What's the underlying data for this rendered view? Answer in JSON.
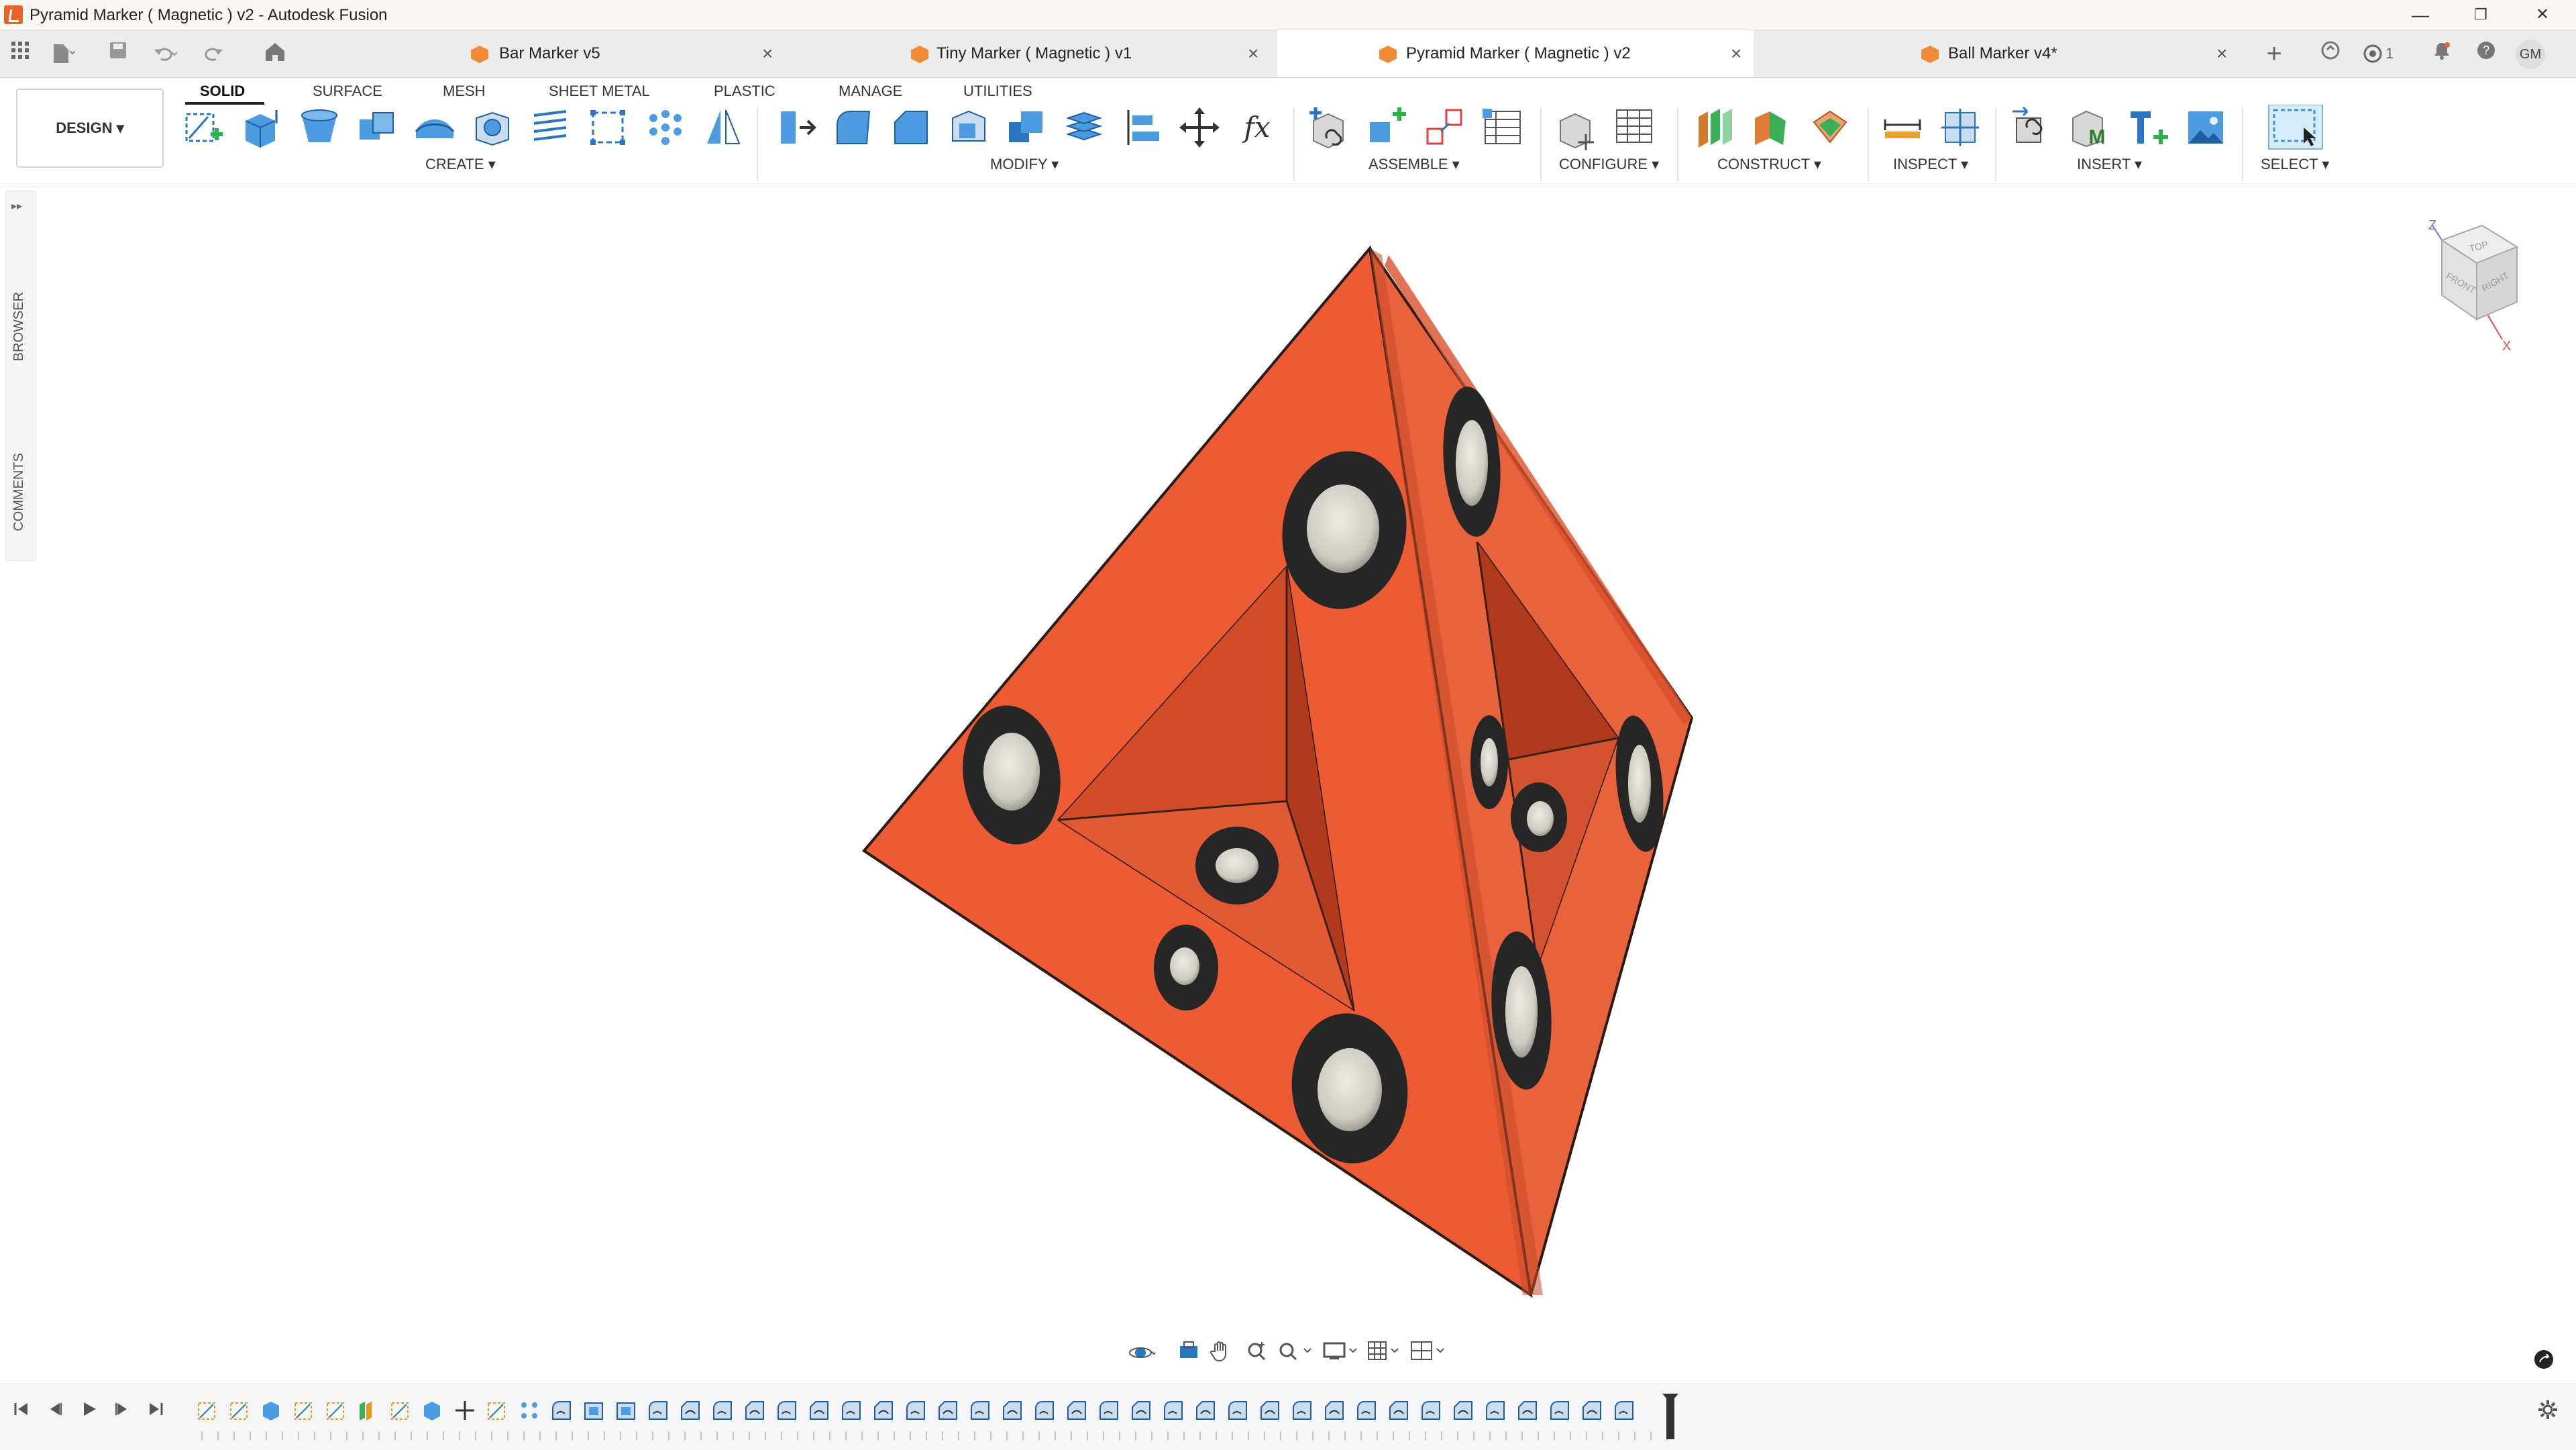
{
  "window": {
    "title": "Pyramid Marker ( Magnetic ) v2 - Autodesk Fusion",
    "minimize": "—",
    "restore": "❐",
    "close": "✕"
  },
  "tabs": [
    {
      "label": "Bar Marker v5",
      "active": false
    },
    {
      "label": "Tiny Marker ( Magnetic ) v1",
      "active": false
    },
    {
      "label": "Pyramid Marker ( Magnetic ) v2",
      "active": true
    },
    {
      "label": "Ball Marker v4*",
      "active": false
    }
  ],
  "tab_close": "×",
  "tabbar_right": {
    "add": "+",
    "jobs_count": "1",
    "user_initials": "GM"
  },
  "toolbar": {
    "workspace": "DESIGN ▾",
    "tabs": [
      "SOLID",
      "SURFACE",
      "MESH",
      "SHEET METAL",
      "PLASTIC",
      "MANAGE",
      "UTILITIES"
    ],
    "active_tab": "SOLID",
    "groups": [
      "CREATE ▾",
      "MODIFY ▾",
      "ASSEMBLE ▾",
      "CONFIGURE ▾",
      "CONSTRUCT ▾",
      "INSPECT ▾",
      "INSERT ▾",
      "SELECT ▾"
    ]
  },
  "side_panel": {
    "expand": "▸▸",
    "browser": "BROWSER",
    "comments": "COMMENTS"
  },
  "viewcube": {
    "top": "TOP",
    "front": "FRONT",
    "right": "RIGHT",
    "axis_z": "Z",
    "axis_x": "X"
  },
  "colors": {
    "model_face_front": "#ec5b34",
    "model_face_side": "#e8623c",
    "model_edge": "#2a1a14",
    "magnet_ring": "#262626",
    "magnet_face": "#d9d5cc",
    "brand_orange": "#e8622a",
    "select_blue": "#3d8fd6"
  },
  "icons": {
    "apps": "apps-grid-icon",
    "file": "file-icon",
    "save": "save-icon",
    "undo": "undo-icon",
    "redo": "redo-icon",
    "home": "home-icon",
    "settings": "gear-icon"
  }
}
